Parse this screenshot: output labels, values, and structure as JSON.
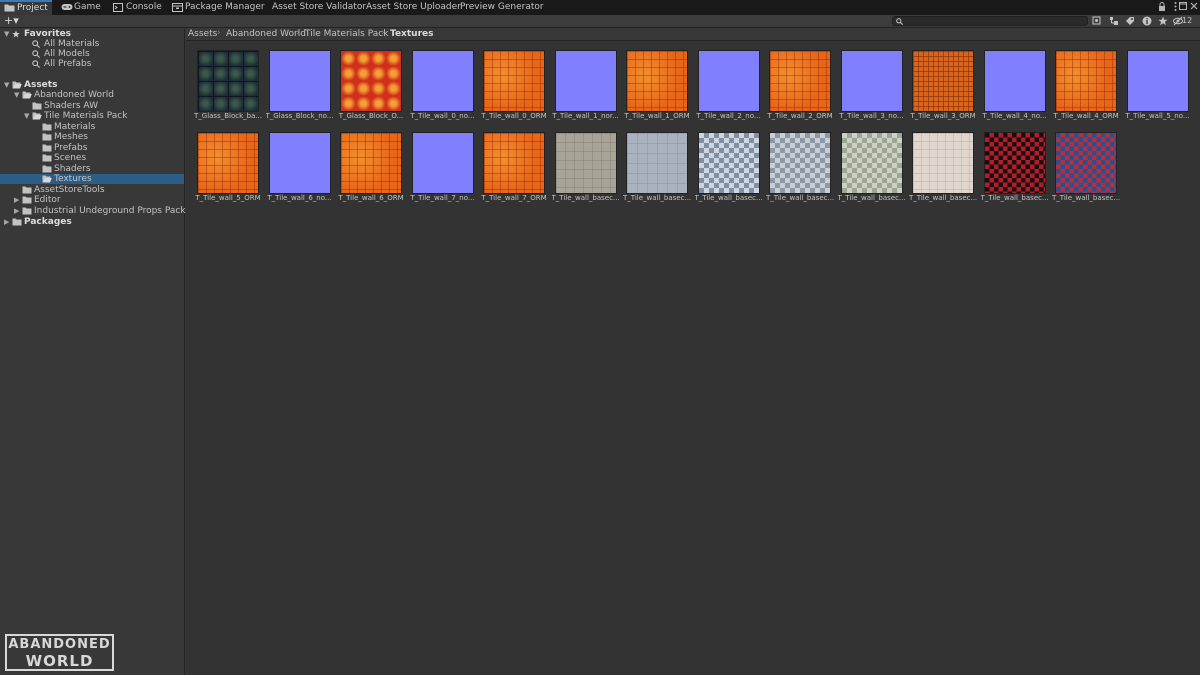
{
  "tabs": [
    {
      "label": "Project",
      "icon": "folder-icon",
      "active": true
    },
    {
      "label": "Game",
      "icon": "gamepad-icon",
      "active": false
    },
    {
      "label": "Console",
      "icon": "console-icon",
      "active": false
    },
    {
      "label": "Package Manager",
      "icon": "package-icon",
      "active": false
    },
    {
      "label": "Asset Store Validator",
      "icon": "",
      "active": false
    },
    {
      "label": "Asset Store Uploader",
      "icon": "",
      "active": false
    },
    {
      "label": "Preview Generator",
      "icon": "",
      "active": false
    }
  ],
  "toolbar": {
    "add_label": "+▾",
    "search_placeholder": "",
    "hidden_count": "12"
  },
  "tree": [
    {
      "label": "Favorites",
      "kind": "star",
      "depth": 0,
      "arrow": "down",
      "bold": true
    },
    {
      "label": "All Materials",
      "kind": "search",
      "depth": 2,
      "arrow": "",
      "bold": false
    },
    {
      "label": "All Models",
      "kind": "search",
      "depth": 2,
      "arrow": "",
      "bold": false
    },
    {
      "label": "All Prefabs",
      "kind": "search",
      "depth": 2,
      "arrow": "",
      "bold": false
    },
    {
      "label": "",
      "kind": "gap",
      "depth": 0,
      "arrow": "",
      "bold": false
    },
    {
      "label": "Assets",
      "kind": "folder-open",
      "depth": 0,
      "arrow": "down",
      "bold": true
    },
    {
      "label": "Abandoned World",
      "kind": "folder-open",
      "depth": 1,
      "arrow": "down",
      "bold": false
    },
    {
      "label": "Shaders AW",
      "kind": "folder",
      "depth": 2,
      "arrow": "",
      "bold": false
    },
    {
      "label": "Tile Materials Pack",
      "kind": "folder-open",
      "depth": 2,
      "arrow": "down",
      "bold": false
    },
    {
      "label": "Materials",
      "kind": "folder",
      "depth": 3,
      "arrow": "",
      "bold": false
    },
    {
      "label": "Meshes",
      "kind": "folder",
      "depth": 3,
      "arrow": "",
      "bold": false
    },
    {
      "label": "Prefabs",
      "kind": "folder",
      "depth": 3,
      "arrow": "",
      "bold": false
    },
    {
      "label": "Scenes",
      "kind": "folder",
      "depth": 3,
      "arrow": "",
      "bold": false
    },
    {
      "label": "Shaders",
      "kind": "folder",
      "depth": 3,
      "arrow": "",
      "bold": false
    },
    {
      "label": "Textures",
      "kind": "folder-open",
      "depth": 3,
      "arrow": "",
      "bold": false,
      "selected": true
    },
    {
      "label": "AssetStoreTools",
      "kind": "folder",
      "depth": 1,
      "arrow": "",
      "bold": false
    },
    {
      "label": "Editor",
      "kind": "folder",
      "depth": 1,
      "arrow": "right",
      "bold": false
    },
    {
      "label": "Industrial Undeground Props Pack",
      "kind": "folder",
      "depth": 1,
      "arrow": "right",
      "bold": false
    },
    {
      "label": "Packages",
      "kind": "folder",
      "depth": 0,
      "arrow": "right",
      "bold": true
    }
  ],
  "logo": {
    "line1": "ABANDONED",
    "line2": "WORLD"
  },
  "breadcrumb": [
    "Assets",
    "Abandoned World",
    "Tile Materials Pack",
    "Textures"
  ],
  "assets": [
    {
      "label": "T_Glass_Block_ba...",
      "kind": "glass-base"
    },
    {
      "label": "T_Glass_Block_no...",
      "kind": "normal"
    },
    {
      "label": "T_Glass_Block_O...",
      "kind": "glass-orm"
    },
    {
      "label": "T_Tile_wall_0_no...",
      "kind": "normal"
    },
    {
      "label": "T_Tile_wall_0_ORM",
      "kind": "orm"
    },
    {
      "label": "T_Tile_wall_1_nor...",
      "kind": "normal"
    },
    {
      "label": "T_Tile_wall_1_ORM",
      "kind": "orm"
    },
    {
      "label": "T_Tile_wall_2_no...",
      "kind": "normal"
    },
    {
      "label": "T_Tile_wall_2_ORM",
      "kind": "orm"
    },
    {
      "label": "T_Tile_wall_3_no...",
      "kind": "normal"
    },
    {
      "label": "T_Tile_wall_3_ORM",
      "kind": "orm-small"
    },
    {
      "label": "T_Tile_wall_4_no...",
      "kind": "normal"
    },
    {
      "label": "T_Tile_wall_4_ORM",
      "kind": "orm"
    },
    {
      "label": "T_Tile_wall_5_no...",
      "kind": "normal"
    },
    {
      "label": "T_Tile_wall_5_ORM",
      "kind": "orm"
    },
    {
      "label": "T_Tile_wall_6_no...",
      "kind": "normal"
    },
    {
      "label": "T_Tile_wall_6_ORM",
      "kind": "orm"
    },
    {
      "label": "T_Tile_wall_7_no...",
      "kind": "normal"
    },
    {
      "label": "T_Tile_wall_7_ORM",
      "kind": "orm"
    },
    {
      "label": "T_Tile_wall_basec...",
      "kind": "stone"
    },
    {
      "label": "T_Tile_wall_basec...",
      "kind": "blue-grey"
    },
    {
      "label": "T_Tile_wall_basec...",
      "kind": "check-blue"
    },
    {
      "label": "T_Tile_wall_basec...",
      "kind": "check-grey"
    },
    {
      "label": "T_Tile_wall_basec...",
      "kind": "check-green"
    },
    {
      "label": "T_Tile_wall_basec...",
      "kind": "cream"
    },
    {
      "label": "T_Tile_wall_basec...",
      "kind": "check-red"
    },
    {
      "label": "T_Tile_wall_basec...",
      "kind": "check-redblue"
    }
  ],
  "colors": {
    "accent_tab": "#3a79bb",
    "selection": "#2c5d87",
    "normal_map": "#7f7ffe",
    "orm": "#ea6a14"
  }
}
